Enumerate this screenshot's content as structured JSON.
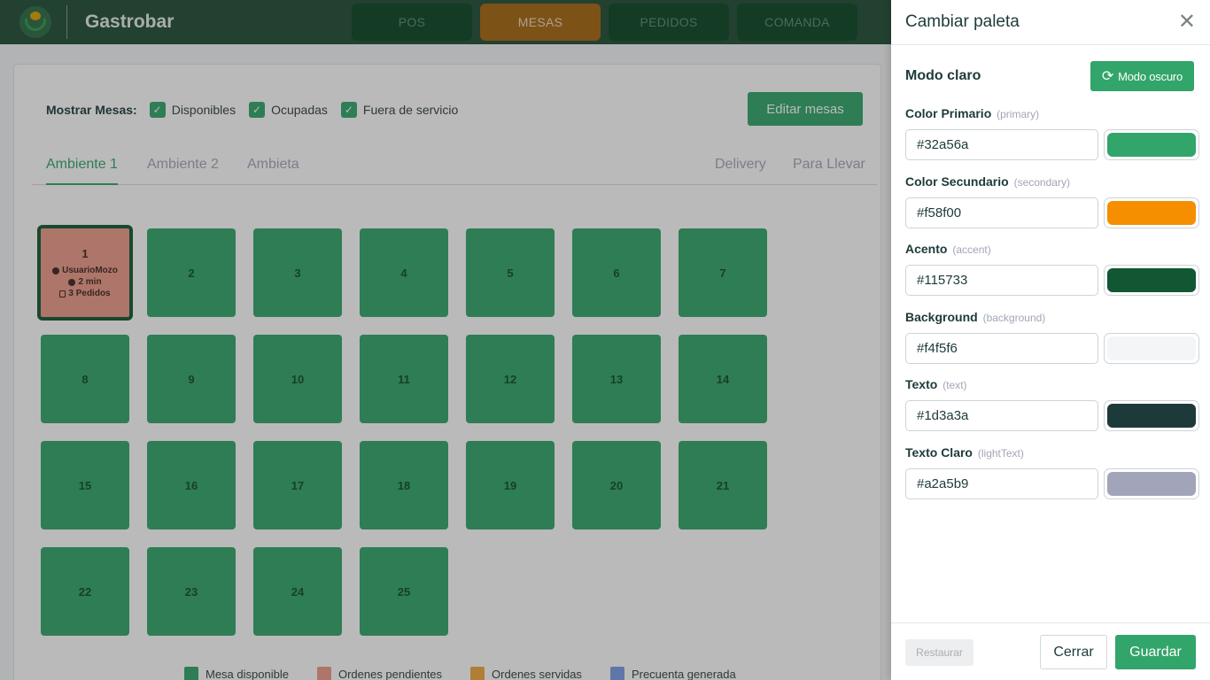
{
  "header": {
    "brand": "Gastrobar",
    "nav": [
      "POS",
      "MESAS",
      "PEDIDOS",
      "COMANDA"
    ],
    "active_nav": "MESAS"
  },
  "filters": {
    "label": "Mostrar Mesas:",
    "options": [
      "Disponibles",
      "Ocupadas",
      "Fuera de servicio"
    ],
    "edit_label": "Editar mesas"
  },
  "tabs": {
    "left": [
      "Ambiente 1",
      "Ambiente 2",
      "Ambieta"
    ],
    "right": [
      "Delivery",
      "Para Llevar"
    ],
    "active": "Ambiente 1"
  },
  "tables": {
    "pending": {
      "number": "1",
      "user": "UsuarioMozo",
      "time": "2 min",
      "orders": "3 Pedidos"
    },
    "numbers": [
      "2",
      "3",
      "4",
      "5",
      "6",
      "7",
      "8",
      "9",
      "10",
      "11",
      "12",
      "13",
      "14",
      "15",
      "16",
      "17",
      "18",
      "19",
      "20",
      "21",
      "22",
      "23",
      "24",
      "25"
    ]
  },
  "legend": [
    {
      "label": "Mesa disponible",
      "color": "#32a56a"
    },
    {
      "label": "Ordenes pendientes",
      "color": "#ee9a8a"
    },
    {
      "label": "Ordenes servidas",
      "color": "#f0a83c"
    },
    {
      "label": "Precuenta generada",
      "color": "#7b9be6"
    }
  ],
  "drawer": {
    "title": "Cambiar paleta",
    "mode_label": "Modo claro",
    "mode_button": "Modo oscuro",
    "fields": [
      {
        "label": "Color Primario",
        "key": "(primary)",
        "value": "#32a56a",
        "color": "#32a56a"
      },
      {
        "label": "Color Secundario",
        "key": "(secondary)",
        "value": "#f58f00",
        "color": "#f58f00"
      },
      {
        "label": "Acento",
        "key": "(accent)",
        "value": "#115733",
        "color": "#115733"
      },
      {
        "label": "Background",
        "key": "(background)",
        "value": "#f4f5f6",
        "color": "#f4f5f6"
      },
      {
        "label": "Texto",
        "key": "(text)",
        "value": "#1d3a3a",
        "color": "#1d3a3a"
      },
      {
        "label": "Texto Claro",
        "key": "(lightText)",
        "value": "#a2a5b9",
        "color": "#a2a5b9"
      }
    ],
    "reset_label": "Restaurar",
    "cancel_label": "Cerrar",
    "save_label": "Guardar"
  }
}
